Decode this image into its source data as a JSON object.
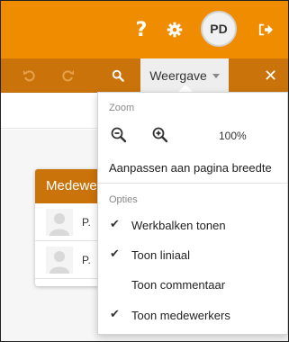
{
  "header": {
    "avatar_initials": "PD",
    "accent_color": "#f08c00",
    "icons": [
      "help-icon",
      "gear-icon",
      "logout-icon"
    ]
  },
  "toolbar": {
    "view_label": "Weergave",
    "toolbar_color": "#c9730a",
    "icons": [
      "undo-icon",
      "redo-icon",
      "search-icon",
      "close-icon"
    ]
  },
  "collaborators": {
    "title": "Medewerkers",
    "rows": [
      {
        "name": "P."
      },
      {
        "name": "P."
      }
    ]
  },
  "view_menu": {
    "zoom_section": "Zoom",
    "zoom_level": "100%",
    "fit_width": "Aanpassen aan pagina breedte",
    "options_section": "Opties",
    "options": [
      {
        "label": "Werkbalken tonen",
        "checked": true
      },
      {
        "label": "Toon liniaal",
        "checked": true
      },
      {
        "label": "Toon commentaar",
        "checked": false
      },
      {
        "label": "Toon medewerkers",
        "checked": true
      }
    ]
  }
}
